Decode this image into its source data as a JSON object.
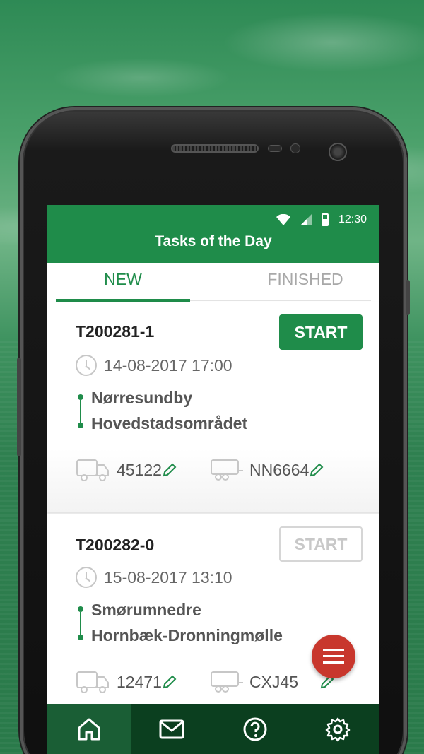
{
  "status_bar": {
    "time": "12:30"
  },
  "app": {
    "title": "Tasks of the Day"
  },
  "tabs": [
    {
      "label": "NEW",
      "active": true
    },
    {
      "label": "FINISHED",
      "active": false
    }
  ],
  "tasks": [
    {
      "id": "T200281-1",
      "start_label": "START",
      "start_enabled": true,
      "datetime": "14-08-2017 17:00",
      "route_from_a": "Nørres",
      "route_from_b": "undby",
      "route_to_a": "Hoved",
      "route_to_b": "stadsområdet",
      "truck": "45122",
      "trailer": "NN6664"
    },
    {
      "id": "T200282-0",
      "start_label": "START",
      "start_enabled": false,
      "datetime": "15-08-2017 13:10",
      "route_from_a": "Smørumnedre",
      "route_from_b": "",
      "route_to_a": "Hornbæk-Dronningmølle",
      "route_to_b": "",
      "truck": "12471",
      "trailer": "CXJ45"
    }
  ],
  "colors": {
    "primary": "#1f8c4a",
    "fab": "#c8372d",
    "nav_bg": "#0b3f1f"
  },
  "icons": [
    "wifi-icon",
    "signal-icon",
    "battery-icon",
    "clock-icon",
    "truck-icon",
    "trailer-icon",
    "pencil-icon",
    "menu-icon",
    "home-icon",
    "mail-icon",
    "help-icon",
    "settings-icon"
  ]
}
